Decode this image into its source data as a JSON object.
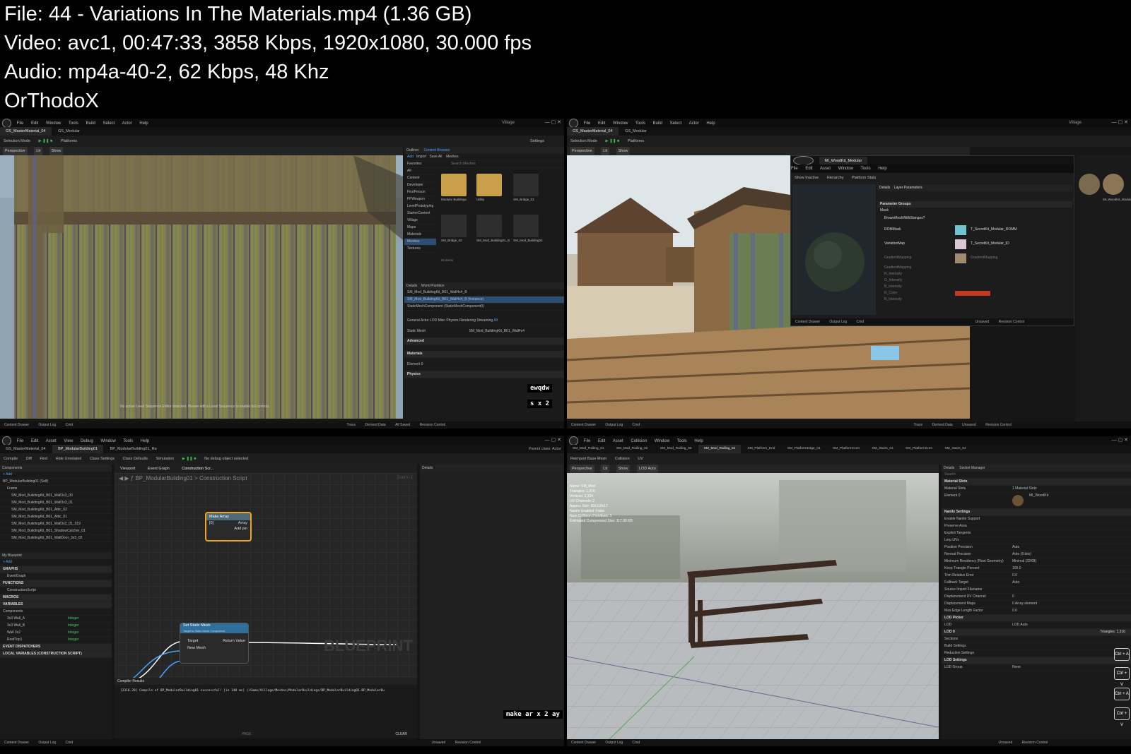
{
  "info": {
    "file_line": "File: 44 - Variations In The Materials.mp4 (1.36 GB)",
    "video_line": "Video: avc1, 00:47:33, 3858 Kbps, 1920x1080, 30.000 fps",
    "audio_line": "Audio: mp4a-40-2, 62 Kbps, 48 Khz",
    "uploader": "OrThodoX"
  },
  "menu": [
    "File",
    "Edit",
    "Window",
    "Tools",
    "Build",
    "Select",
    "Actor",
    "Help"
  ],
  "bp_menu": [
    "File",
    "Edit",
    "Asset",
    "View",
    "Debug",
    "Window",
    "Tools",
    "Help"
  ],
  "mesh_menu": [
    "File",
    "Edit",
    "Asset",
    "Collision",
    "Window",
    "Tools",
    "Help"
  ],
  "panel1": {
    "project": "Village",
    "tabs": [
      "GS_MasterMaterial_04",
      "GS_Modular"
    ],
    "toolbar": [
      "Selection Mode",
      "Platforms",
      "Settings"
    ],
    "viewport_buttons": [
      "Perspective",
      "Lit",
      "Show"
    ],
    "outliner_tabs": [
      "Outliner",
      "Content Browser"
    ],
    "browser_actions": [
      "Add",
      "Import",
      "Save All"
    ],
    "browser_path": "Meshes",
    "search_placeholder": "Search Meshes",
    "favorites": "Favorites",
    "folders": [
      "All",
      "Content",
      "Developer",
      "FirstPerson",
      "FPWeapon",
      "LevelPrototyping",
      "StarterContent",
      "Village",
      "Maps",
      "Materials",
      "Meshes",
      "Textures"
    ],
    "assets": [
      "Modular Buildings",
      "Utility",
      "SM_Bridge_01",
      "SM_Bridge_02",
      "SM_Mod_Building01_B",
      "SM_Mod_Building02"
    ],
    "item_count": "61 items",
    "details_tabs": [
      "Details",
      "World Partition"
    ],
    "actor_name": "SM_Mod_BuildingKit_B01_Wall4x4_B",
    "component": "SM_Mod_BuildingKit_B01_Wall4x4_B (Instance)",
    "component_sub": "StaticMeshComponent (StaticMeshComponent0)",
    "filter_tabs": [
      "General",
      "Actor",
      "LOD",
      "Misc",
      "Physics",
      "Rendering",
      "Streaming",
      "All"
    ],
    "static_mesh_label": "Static Mesh",
    "static_mesh_value": "SM_Mod_BuildingKit_B01_Wall4x4",
    "advanced_label": "Advanced",
    "materials_label": "Materials",
    "element_label": "Element 0",
    "physics_label": "Physics",
    "caption_a": "ewqdw",
    "caption_b": "s x 2",
    "status_msg": "No active Level Sequence Editor detected. Please edit a Level Sequence to enable full controls.",
    "statusbar": [
      "Content Drawer",
      "Output Log",
      "Cmd",
      "Trace",
      "Derived Data",
      "All Saved",
      "Revision Control"
    ]
  },
  "panel2": {
    "project": "Village",
    "tabs": [
      "GS_MasterMaterial_04",
      "GS_Modular"
    ],
    "dialog_tab": "MI_WoodKit_Modular",
    "dialog_menu": [
      "File",
      "Edit",
      "Asset",
      "Window",
      "Tools",
      "Help"
    ],
    "dialog_toolbar": [
      "Show Inactive",
      "Hierarchy",
      "Platform Stats"
    ],
    "dialog_panels": [
      "Details",
      "Layer Parameters"
    ],
    "param_group": "Parameter Groups",
    "mask_group": "Mask",
    "params": [
      "BrownMeshWithStanges?",
      "ROMMask",
      "VariationMap",
      "GradientMapping",
      "GradientMapping",
      "R_Intensity",
      "G_Intensity",
      "B_Intensity",
      "R_Color",
      "B_Intensity"
    ],
    "texture_values": [
      "T_SecretKit_Modular_ROMM",
      "T_SecretKit_Modular_ID",
      "GradientMapping"
    ],
    "dialog_status": [
      "Content Drawer",
      "Output Log",
      "Cmd",
      "Unsaved",
      "Revision Control"
    ],
    "asset_name": "MI_WoodKit_Modular",
    "statusbar": [
      "Content Drawer",
      "Output Log",
      "Cmd",
      "Trace",
      "Derived Data",
      "Unsaved",
      "Revision Control"
    ]
  },
  "panel3": {
    "tabs": [
      "GS_MasterMaterial_04",
      "BP_ModularBuilding01",
      "BP_ModularBuilding01_Ra"
    ],
    "parent_class": "Parent class: Actor",
    "toolbar": [
      "Compile",
      "Diff",
      "Find",
      "Hide Unrelated",
      "Class Settings",
      "Class Defaults",
      "Simulation",
      "No debug object selected"
    ],
    "components_header": "Components",
    "component_root": "BP_ModularBuilding01 (Self)",
    "frame": "Frame",
    "components": [
      "SM_Mod_BuildingKit_B01_Wall3x3_00",
      "SM_Mod_BuildingKit_B01_Wall3x3_01",
      "SM_Mod_BuildingKit_B01_Attic_02",
      "SM_Mod_BuildingKit_B01_Attic_01",
      "SM_Mod_BuildingKit_B01_Wall3x2_01_019",
      "SM_Mod_BuildingKit_B01_ShadowCatcher_01",
      "SM_Mod_BuildingKit_B01_WallDoor_3x3_02"
    ],
    "my_blueprint": "My Blueprint",
    "graphs": "GRAPHS",
    "event_graph": "EventGraph",
    "functions": "FUNCTIONS",
    "construction_script": "ConstructionScript",
    "macros": "MACROS",
    "variables": "VARIABLES",
    "variables_section": "Components",
    "vars": [
      {
        "name": "3x3 Wall_A",
        "type": "Integer"
      },
      {
        "name": "3x3 Wall_B",
        "type": "Integer"
      },
      {
        "name": "Wall 3x2",
        "type": "Integer"
      },
      {
        "name": "RoofTop1",
        "type": "Integer"
      }
    ],
    "event_dispatchers": "EVENT DISPATCHERS",
    "local_variables": "LOCAL VARIABLES (CONSTRUCTION SCRIPT)",
    "graph_tabs": [
      "Viewport",
      "Event Graph",
      "Construction Scr..."
    ],
    "breadcrumb_root": "BP_ModularBuilding01",
    "breadcrumb_leaf": "Construction Script",
    "zoom": "Zoom -1",
    "details_tab": "Details",
    "node_make_array": "Make Array",
    "node_make_array_pin0": "[0]",
    "node_make_array_out": "Array",
    "node_make_array_add": "Add pin",
    "node_set_mesh": "Set Static Mesh",
    "node_set_mesh_sub": "Target is Static Mesh Component",
    "node_set_mesh_pins": [
      "Target",
      "New Mesh",
      "Return Value"
    ],
    "watermark": "BLUEPRINT",
    "compiler_tab": "Compiler Results",
    "compiler_log": "[2316.28] Compile of BP_ModularBuilding01 successful! [in 140 ms] (/Game/Village/Meshes/ModularBuildings/BP_ModularBuilding01.BP_ModularBu",
    "page_label": "PAGE",
    "clear_label": "CLEAR",
    "caption": "make ar x 2 ay",
    "statusbar": [
      "Content Drawer",
      "Output Log",
      "Cmd",
      "Unsaved",
      "Revision Control"
    ]
  },
  "panel4": {
    "tabs": [
      "SM_Mod_Railing_01",
      "SM_Mod_Railing_02",
      "SM_Mod_Railing_03",
      "SM_Mod_Railing_04",
      "SM_Platform_End",
      "SM_PlatformEdge_01",
      "SM_PlatformCorn",
      "SM_Stairs_01",
      "SM_PlatformCorn",
      "SM_Stairs_02"
    ],
    "toolbar": [
      "Reimport Base Mesh",
      "Collision",
      "UV"
    ],
    "viewport_buttons": [
      "Perspective",
      "Lit",
      "Show",
      "LOD Auto"
    ],
    "stats": [
      "Name: SM_Mod",
      "Triangles: 1,316",
      "Vertices: 2,334",
      "UV Channels: 2",
      "Approx Size: 93x118x17",
      "Nanite Enabled: False",
      "Num Collision Primitives: 1",
      "Estimated Compressed Size: 117.00 KB"
    ],
    "details_tabs": [
      "Details",
      "Socket Manager"
    ],
    "search_placeholder": "Search",
    "sections": [
      "Material Slots",
      "Nanite Settings",
      "LOD Picker",
      "LOD 0",
      "Sections",
      "Build Settings",
      "Reduction Settings",
      "LOD Settings"
    ],
    "material_slots_label": "Material Slots",
    "material_slots_value": "1 Material Slots",
    "element_label": "Element 0",
    "material_value": "MI_WoodKit",
    "nanite_rows": [
      "Enable Nanite Support",
      "Preserve Area",
      "Explicit Tangents",
      "Lerp UVs",
      "Position Precision",
      "Normal Precision",
      "Minimum Residency (Root Geometry)",
      "Keep Triangle Percent",
      "Trim Relative Error",
      "Fallback Target",
      "Source Import Filename",
      "Displacement UV Channel",
      "Displacement Maps",
      "Max Edge Length Factor"
    ],
    "nanite_values": [
      "",
      "",
      "",
      "",
      "Auto",
      "Auto (8 bits)",
      "Minimal (32KB)",
      "100.0",
      "0.0",
      "Auto",
      "",
      "0",
      "0 Array element",
      "0.0"
    ],
    "lod_label": "LOD",
    "lod_value": "LOD Auto",
    "lod_group_label": "LOD Group",
    "lod_group_value": "None",
    "triangles_readout": "Triangles: 1,316",
    "shortcuts": [
      "Ctrl + A",
      "Ctrl + V",
      "Ctrl + A",
      "Ctrl + V"
    ],
    "statusbar": [
      "Content Drawer",
      "Output Log",
      "Cmd",
      "Unsaved",
      "Revision Control"
    ]
  },
  "colors": {
    "accent": "#4aa3ff",
    "play": "#3fb950",
    "node_highlight": "#f3a41a"
  }
}
